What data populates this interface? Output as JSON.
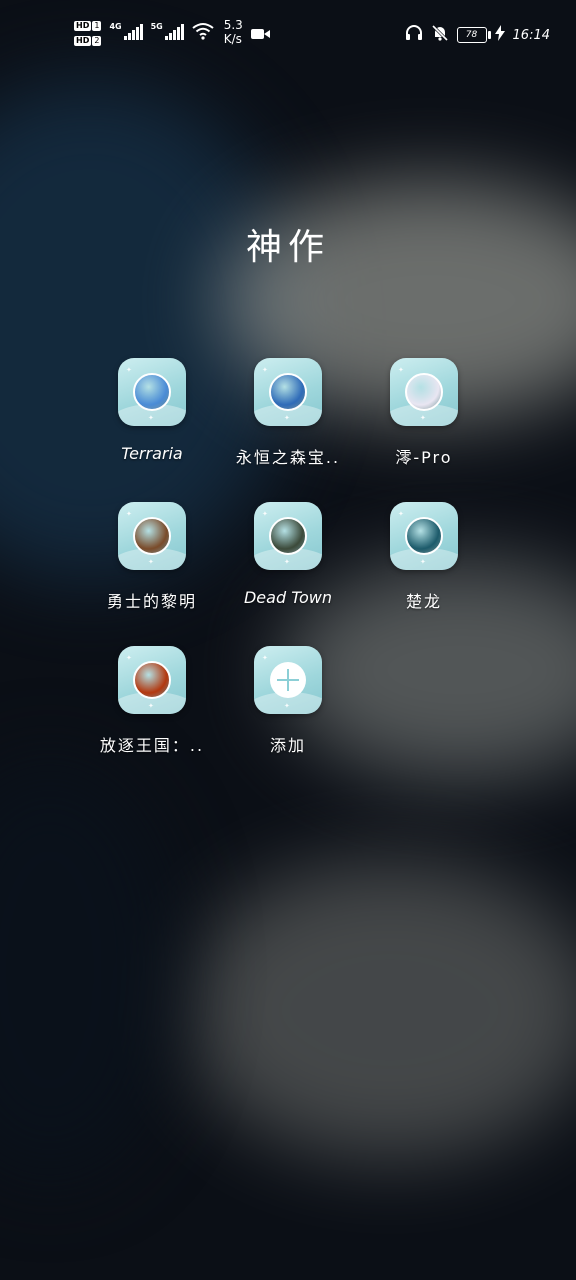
{
  "status_bar": {
    "hd1_label": "HD",
    "hd1_sim": "1",
    "hd2_label": "HD",
    "hd2_sim": "2",
    "sim1_network": "4G",
    "sim2_network": "5G",
    "net_speed_value": "5.3",
    "net_speed_unit": "K/s",
    "battery_level": "78",
    "time": "16:14"
  },
  "folder": {
    "title": "神作",
    "apps": [
      {
        "label": "Terraria",
        "icon": "terraria-tree-icon",
        "color": "#4a8bd6"
      },
      {
        "label": "永恒之森宝..",
        "icon": "forest-game-icon",
        "color": "#2f6bb8"
      },
      {
        "label": "澪-Pro",
        "icon": "anime-girl-icon",
        "color": "#e9e6f2"
      },
      {
        "label": "勇士的黎明",
        "icon": "warriors-icon",
        "color": "#7a4b2a"
      },
      {
        "label": "Dead Town",
        "icon": "dead-town-icon",
        "color": "#3c4a3a"
      },
      {
        "label": "楚龙",
        "icon": "chulong-hero-icon",
        "color": "#1d5b6b"
      },
      {
        "label": "放逐王国：..",
        "icon": "lava-planet-icon",
        "color": "#b3380f"
      },
      {
        "label": "添加",
        "icon": "add-icon",
        "color": "#ffffff"
      }
    ]
  }
}
